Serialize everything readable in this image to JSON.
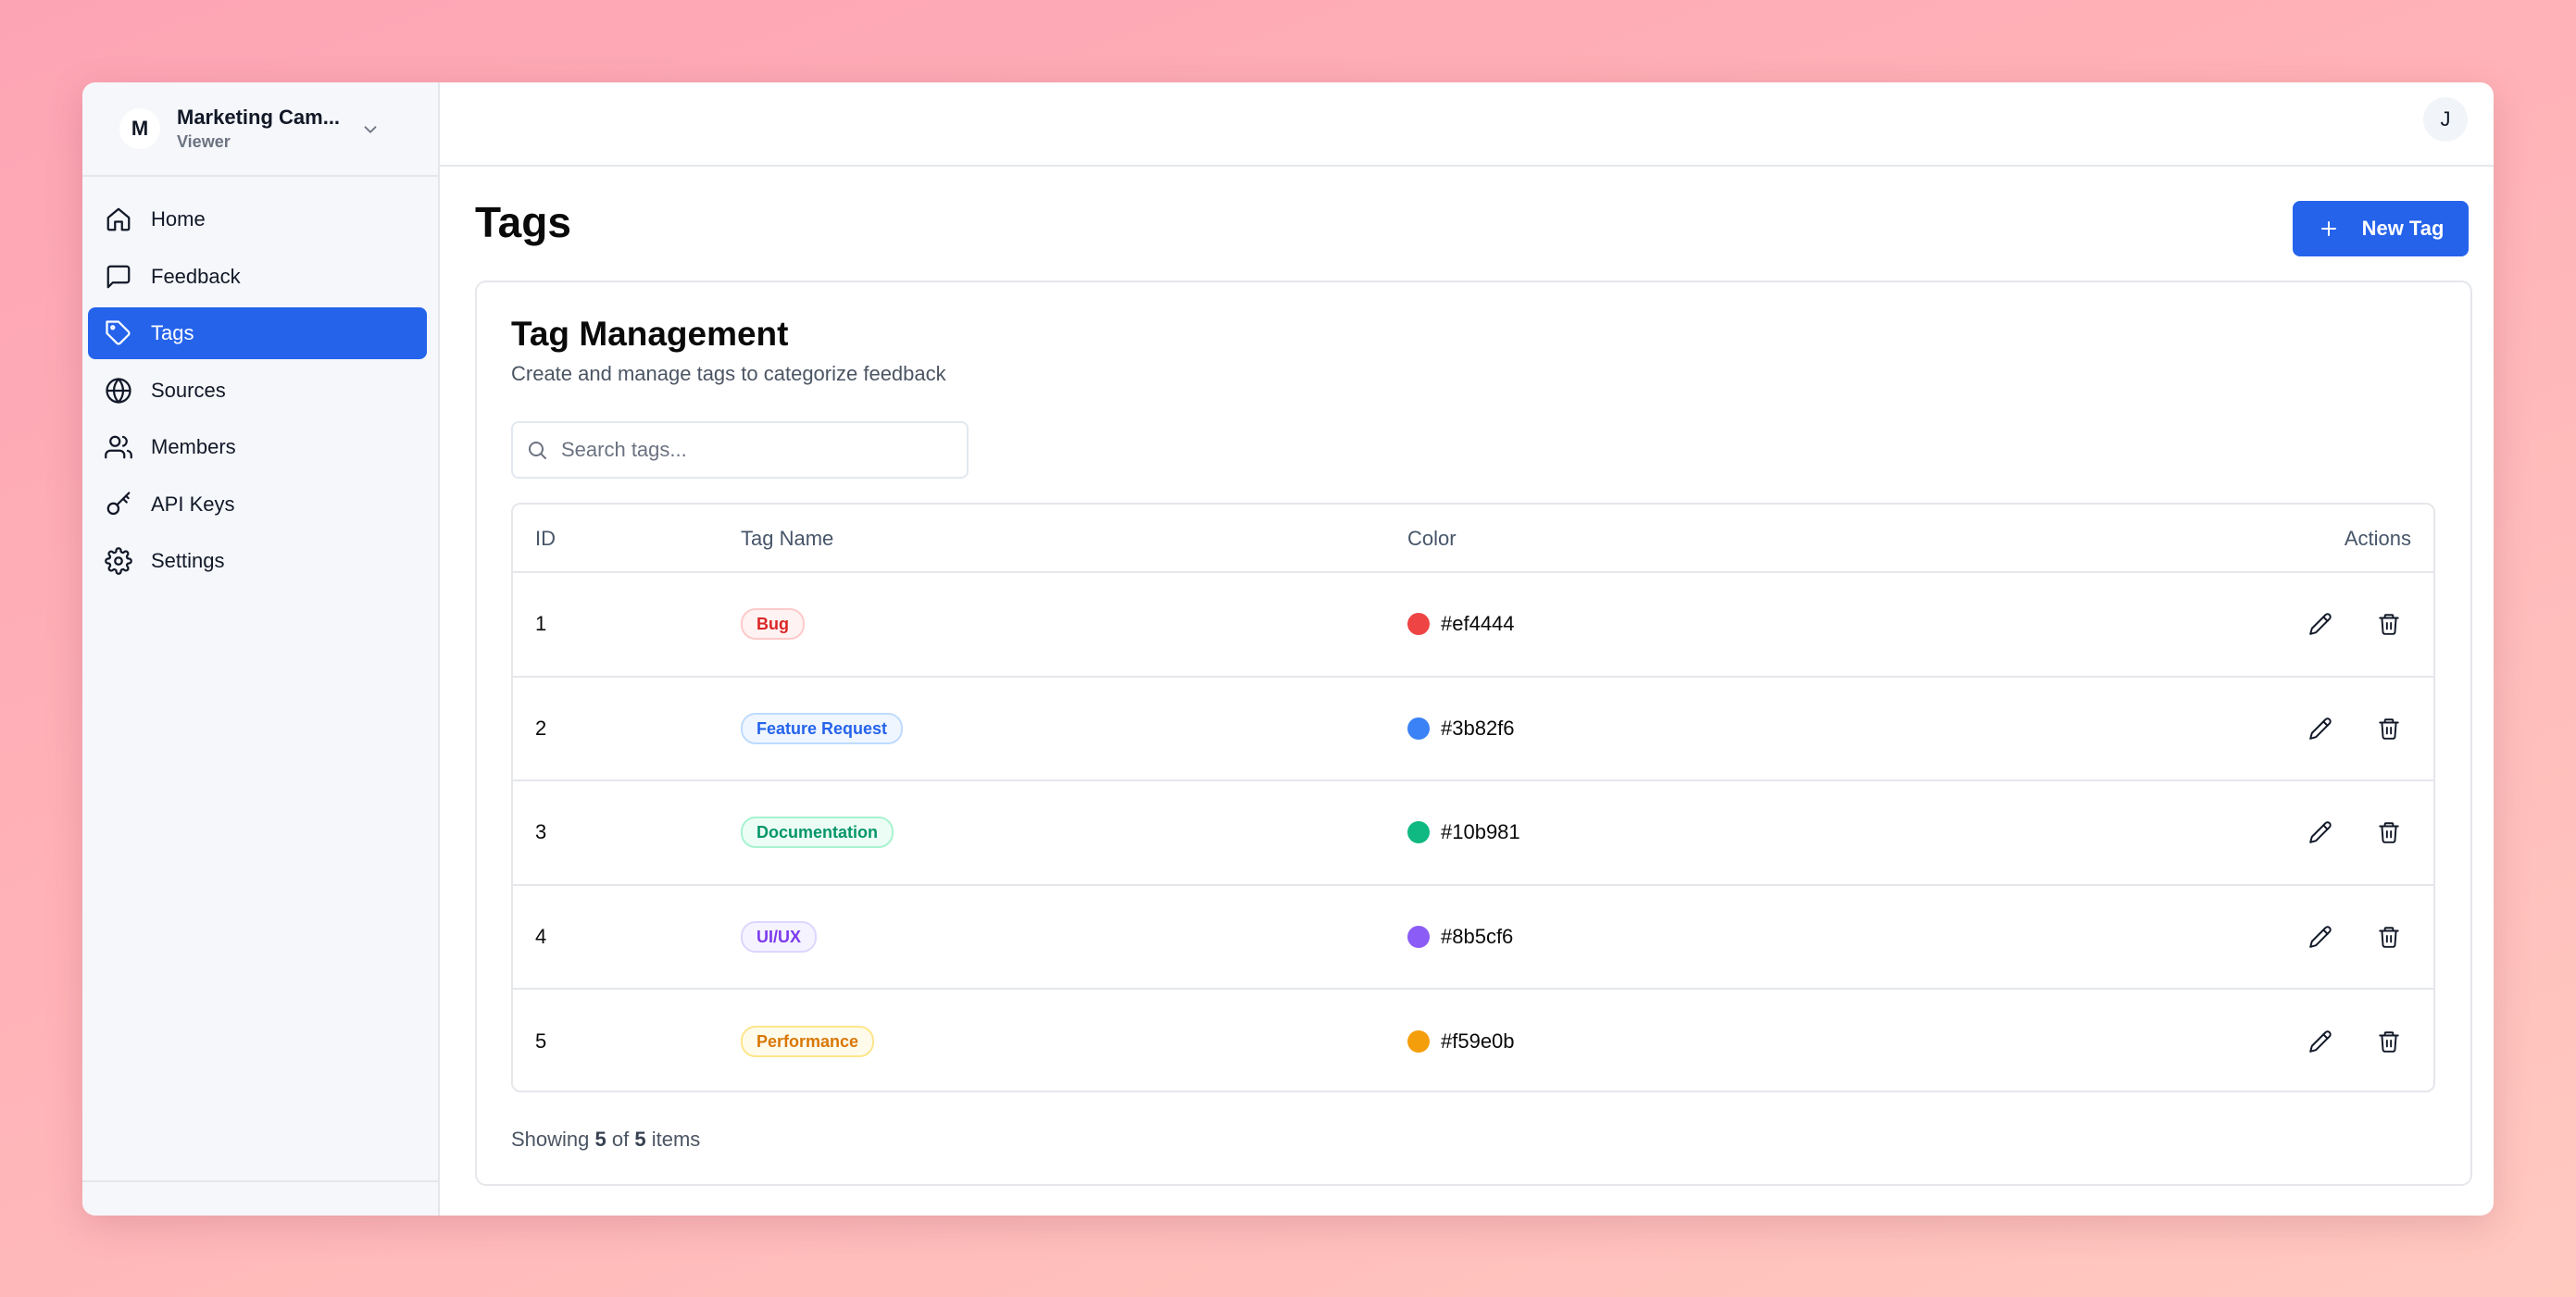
{
  "workspace": {
    "initial": "M",
    "name": "Marketing Cam...",
    "role": "Viewer"
  },
  "sidebar": {
    "items": [
      {
        "label": "Home",
        "icon": "home-icon",
        "active": false
      },
      {
        "label": "Feedback",
        "icon": "message-square-icon",
        "active": false
      },
      {
        "label": "Tags",
        "icon": "tag-icon",
        "active": true
      },
      {
        "label": "Sources",
        "icon": "globe-icon",
        "active": false
      },
      {
        "label": "Members",
        "icon": "users-icon",
        "active": false
      },
      {
        "label": "API Keys",
        "icon": "key-icon",
        "active": false
      },
      {
        "label": "Settings",
        "icon": "gear-icon",
        "active": false
      }
    ]
  },
  "header": {
    "user_initial": "J"
  },
  "page": {
    "title": "Tags",
    "new_button_label": "New Tag"
  },
  "card": {
    "title": "Tag Management",
    "subtitle": "Create and manage tags to categorize feedback",
    "search_placeholder": "Search tags..."
  },
  "table": {
    "columns": {
      "id": "ID",
      "name": "Tag Name",
      "color": "Color",
      "actions": "Actions"
    },
    "rows": [
      {
        "id": "1",
        "name": "Bug",
        "color": "#ef4444"
      },
      {
        "id": "2",
        "name": "Feature Request",
        "color": "#3b82f6"
      },
      {
        "id": "3",
        "name": "Documentation",
        "color": "#10b981"
      },
      {
        "id": "4",
        "name": "UI/UX",
        "color": "#8b5cf6"
      },
      {
        "id": "5",
        "name": "Performance",
        "color": "#f59e0b"
      }
    ]
  },
  "footer": {
    "prefix": "Showing",
    "shown": "5",
    "of_word": "of",
    "total": "5",
    "suffix": "items"
  },
  "colors": {
    "accent": "#2563eb",
    "sidebar_bg": "#f6f7fb",
    "border": "#e5e7eb"
  }
}
